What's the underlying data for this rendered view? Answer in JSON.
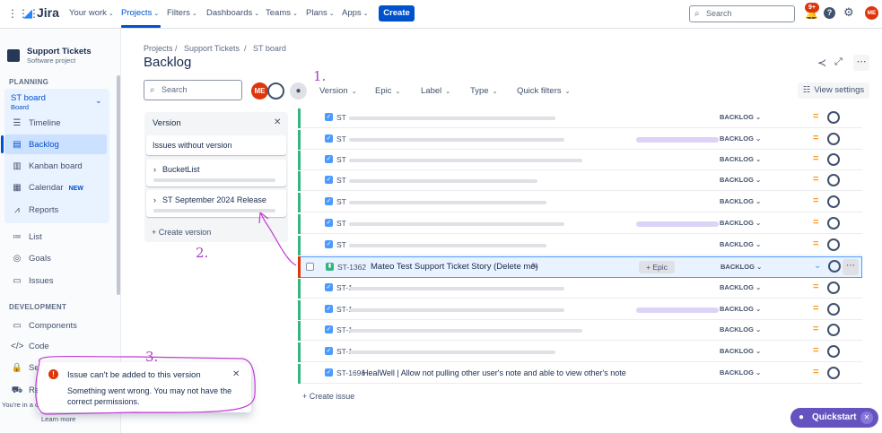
{
  "nav": {
    "logo": "Jira",
    "items": [
      {
        "label": "Your work"
      },
      {
        "label": "Projects"
      },
      {
        "label": "Filters"
      },
      {
        "label": "Dashboards"
      },
      {
        "label": "Teams"
      },
      {
        "label": "Plans"
      },
      {
        "label": "Apps"
      }
    ],
    "create": "Create",
    "search_placeholder": "Search",
    "notif_badge": "9+",
    "user_initials": "ME"
  },
  "sidebar": {
    "project_name": "Support Tickets",
    "project_type": "Software project",
    "planning_heading": "PLANNING",
    "board_name": "ST board",
    "board_sub": "Board",
    "planning_items": [
      {
        "label": "Timeline",
        "icon": "timeline-icon"
      },
      {
        "label": "Backlog",
        "icon": "backlog-icon"
      },
      {
        "label": "Kanban board",
        "icon": "board-icon"
      },
      {
        "label": "Calendar",
        "icon": "calendar-icon",
        "badge": "NEW"
      },
      {
        "label": "Reports",
        "icon": "reports-icon"
      }
    ],
    "other_items": [
      {
        "label": "List",
        "icon": "list-icon"
      },
      {
        "label": "Goals",
        "icon": "goals-icon"
      },
      {
        "label": "Issues",
        "icon": "issues-icon"
      }
    ],
    "development_heading": "DEVELOPMENT",
    "development_items": [
      {
        "label": "Components",
        "icon": "components-icon"
      },
      {
        "label": "Code",
        "icon": "code-icon"
      },
      {
        "label": "Se",
        "icon": "security-icon"
      },
      {
        "label": "Re",
        "icon": "releases-icon"
      }
    ],
    "footer_text": "You're in a c",
    "learn_more": "Learn more"
  },
  "main": {
    "breadcrumb": [
      "Projects",
      "Support Tickets",
      "ST board"
    ],
    "title": "Backlog",
    "search_placeholder": "Search",
    "avatar_initials": "ME",
    "filters": [
      "Version",
      "Epic",
      "Label",
      "Type",
      "Quick filters"
    ],
    "view_settings": "View settings"
  },
  "version_panel": {
    "title": "Version",
    "without_version": "Issues without version",
    "versions": [
      "BucketList",
      "ST September 2024 Release"
    ],
    "create_version": "Create version"
  },
  "issues": [
    {
      "key": "ST",
      "status": "BACKLOG"
    },
    {
      "key": "ST",
      "status": "BACKLOG"
    },
    {
      "key": "ST",
      "status": "BACKLOG"
    },
    {
      "key": "ST",
      "status": "BACKLOG"
    },
    {
      "key": "ST",
      "status": "BACKLOG"
    },
    {
      "key": "ST",
      "status": "BACKLOG"
    },
    {
      "key": "ST",
      "status": "BACKLOG"
    },
    {
      "key": "ST-1362",
      "summary": "Mateo Test Support Ticket Story (Delete me)",
      "epic": "+ Epic",
      "status": "BACKLOG",
      "highlighted": true
    },
    {
      "key": "ST-1",
      "status": "BACKLOG"
    },
    {
      "key": "ST-1",
      "status": "BACKLOG"
    },
    {
      "key": "ST-1",
      "status": "BACKLOG"
    },
    {
      "key": "ST-1",
      "status": "BACKLOG"
    },
    {
      "key": "ST-1696",
      "summary": "HealWell | Allow not pulling other user's note and able to view other's note",
      "status": "BACKLOG"
    }
  ],
  "create_issue": "Create issue",
  "toast": {
    "title": "Issue can't be added to this version",
    "body": "Something went wrong. You may not have the correct permissions."
  },
  "quickstart": "Quickstart",
  "annotations": [
    "1.",
    "2.",
    "3."
  ]
}
